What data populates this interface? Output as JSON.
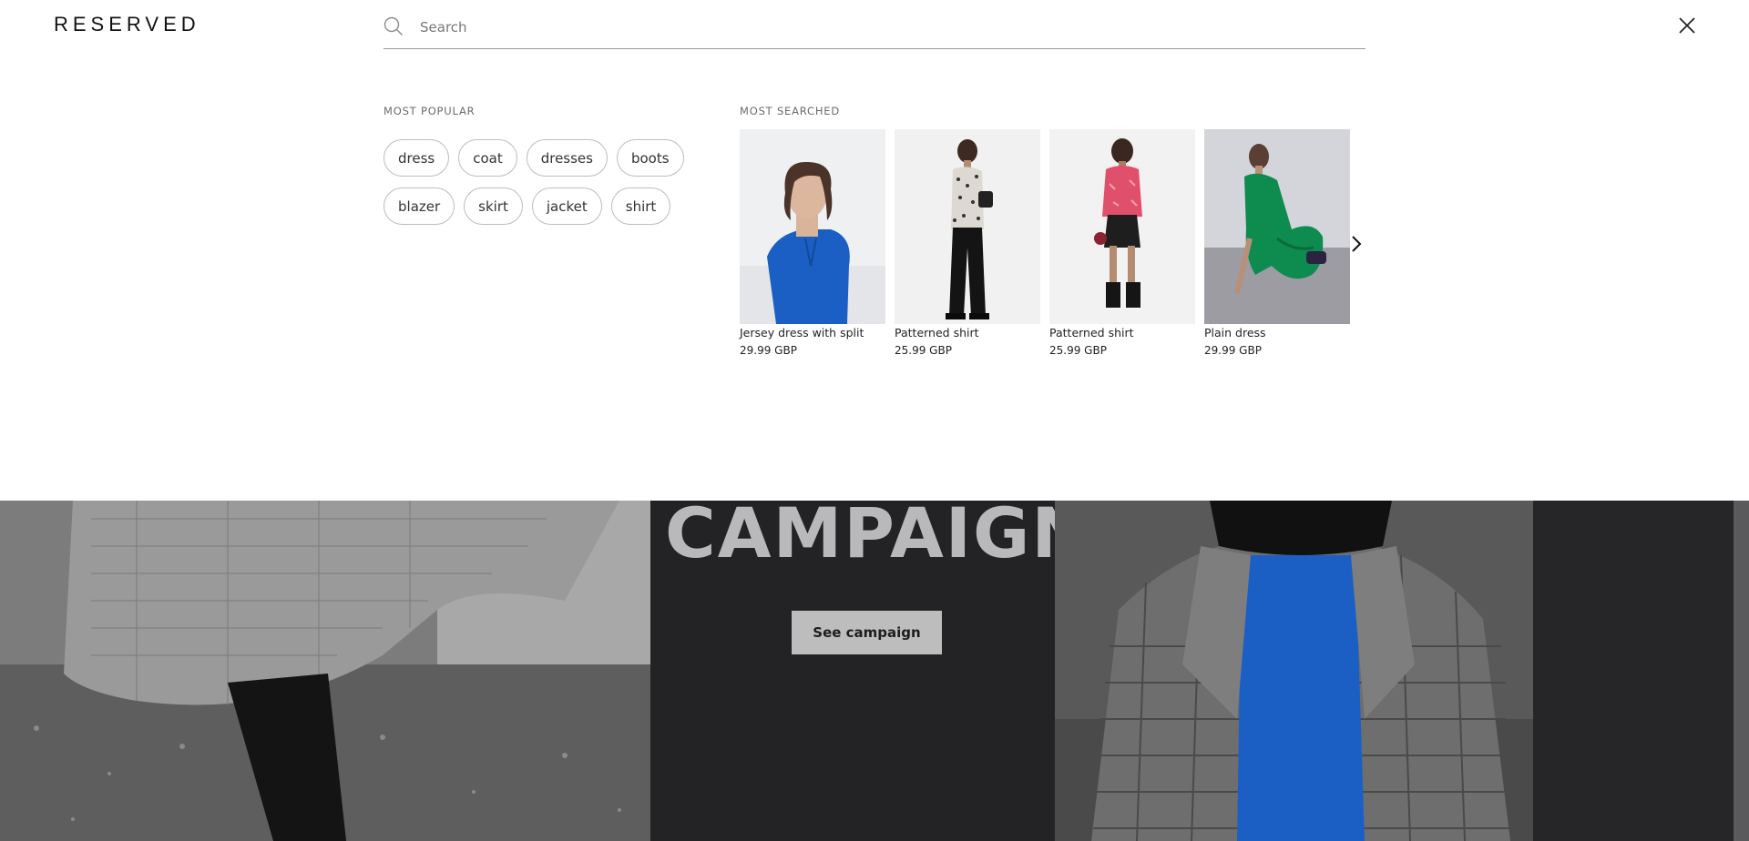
{
  "header": {
    "logo": "RESERVED",
    "search_placeholder": "Search",
    "search_value": ""
  },
  "most_popular": {
    "title": "MOST POPULAR",
    "tags": [
      "dress",
      "coat",
      "dresses",
      "boots",
      "blazer",
      "skirt",
      "jacket",
      "shirt"
    ]
  },
  "most_searched": {
    "title": "MOST SEARCHED",
    "products": [
      {
        "name": "Jersey dress with split",
        "price": "29.99 GBP",
        "color": "#1b5fc4"
      },
      {
        "name": "Patterned shirt",
        "price": "25.99 GBP",
        "color": "#1a1a1a"
      },
      {
        "name": "Patterned shirt",
        "price": "25.99 GBP",
        "color": "#e0506a"
      },
      {
        "name": "Plain dress",
        "price": "29.99 GBP",
        "color": "#0e8c50"
      }
    ]
  },
  "campaign": {
    "title": "CAMPAIGN",
    "button_label": "See campaign"
  },
  "colors": {
    "accent_blue": "#1b5fc4",
    "campaign_bg": "#232325",
    "button_bg": "#bdbdbd"
  }
}
